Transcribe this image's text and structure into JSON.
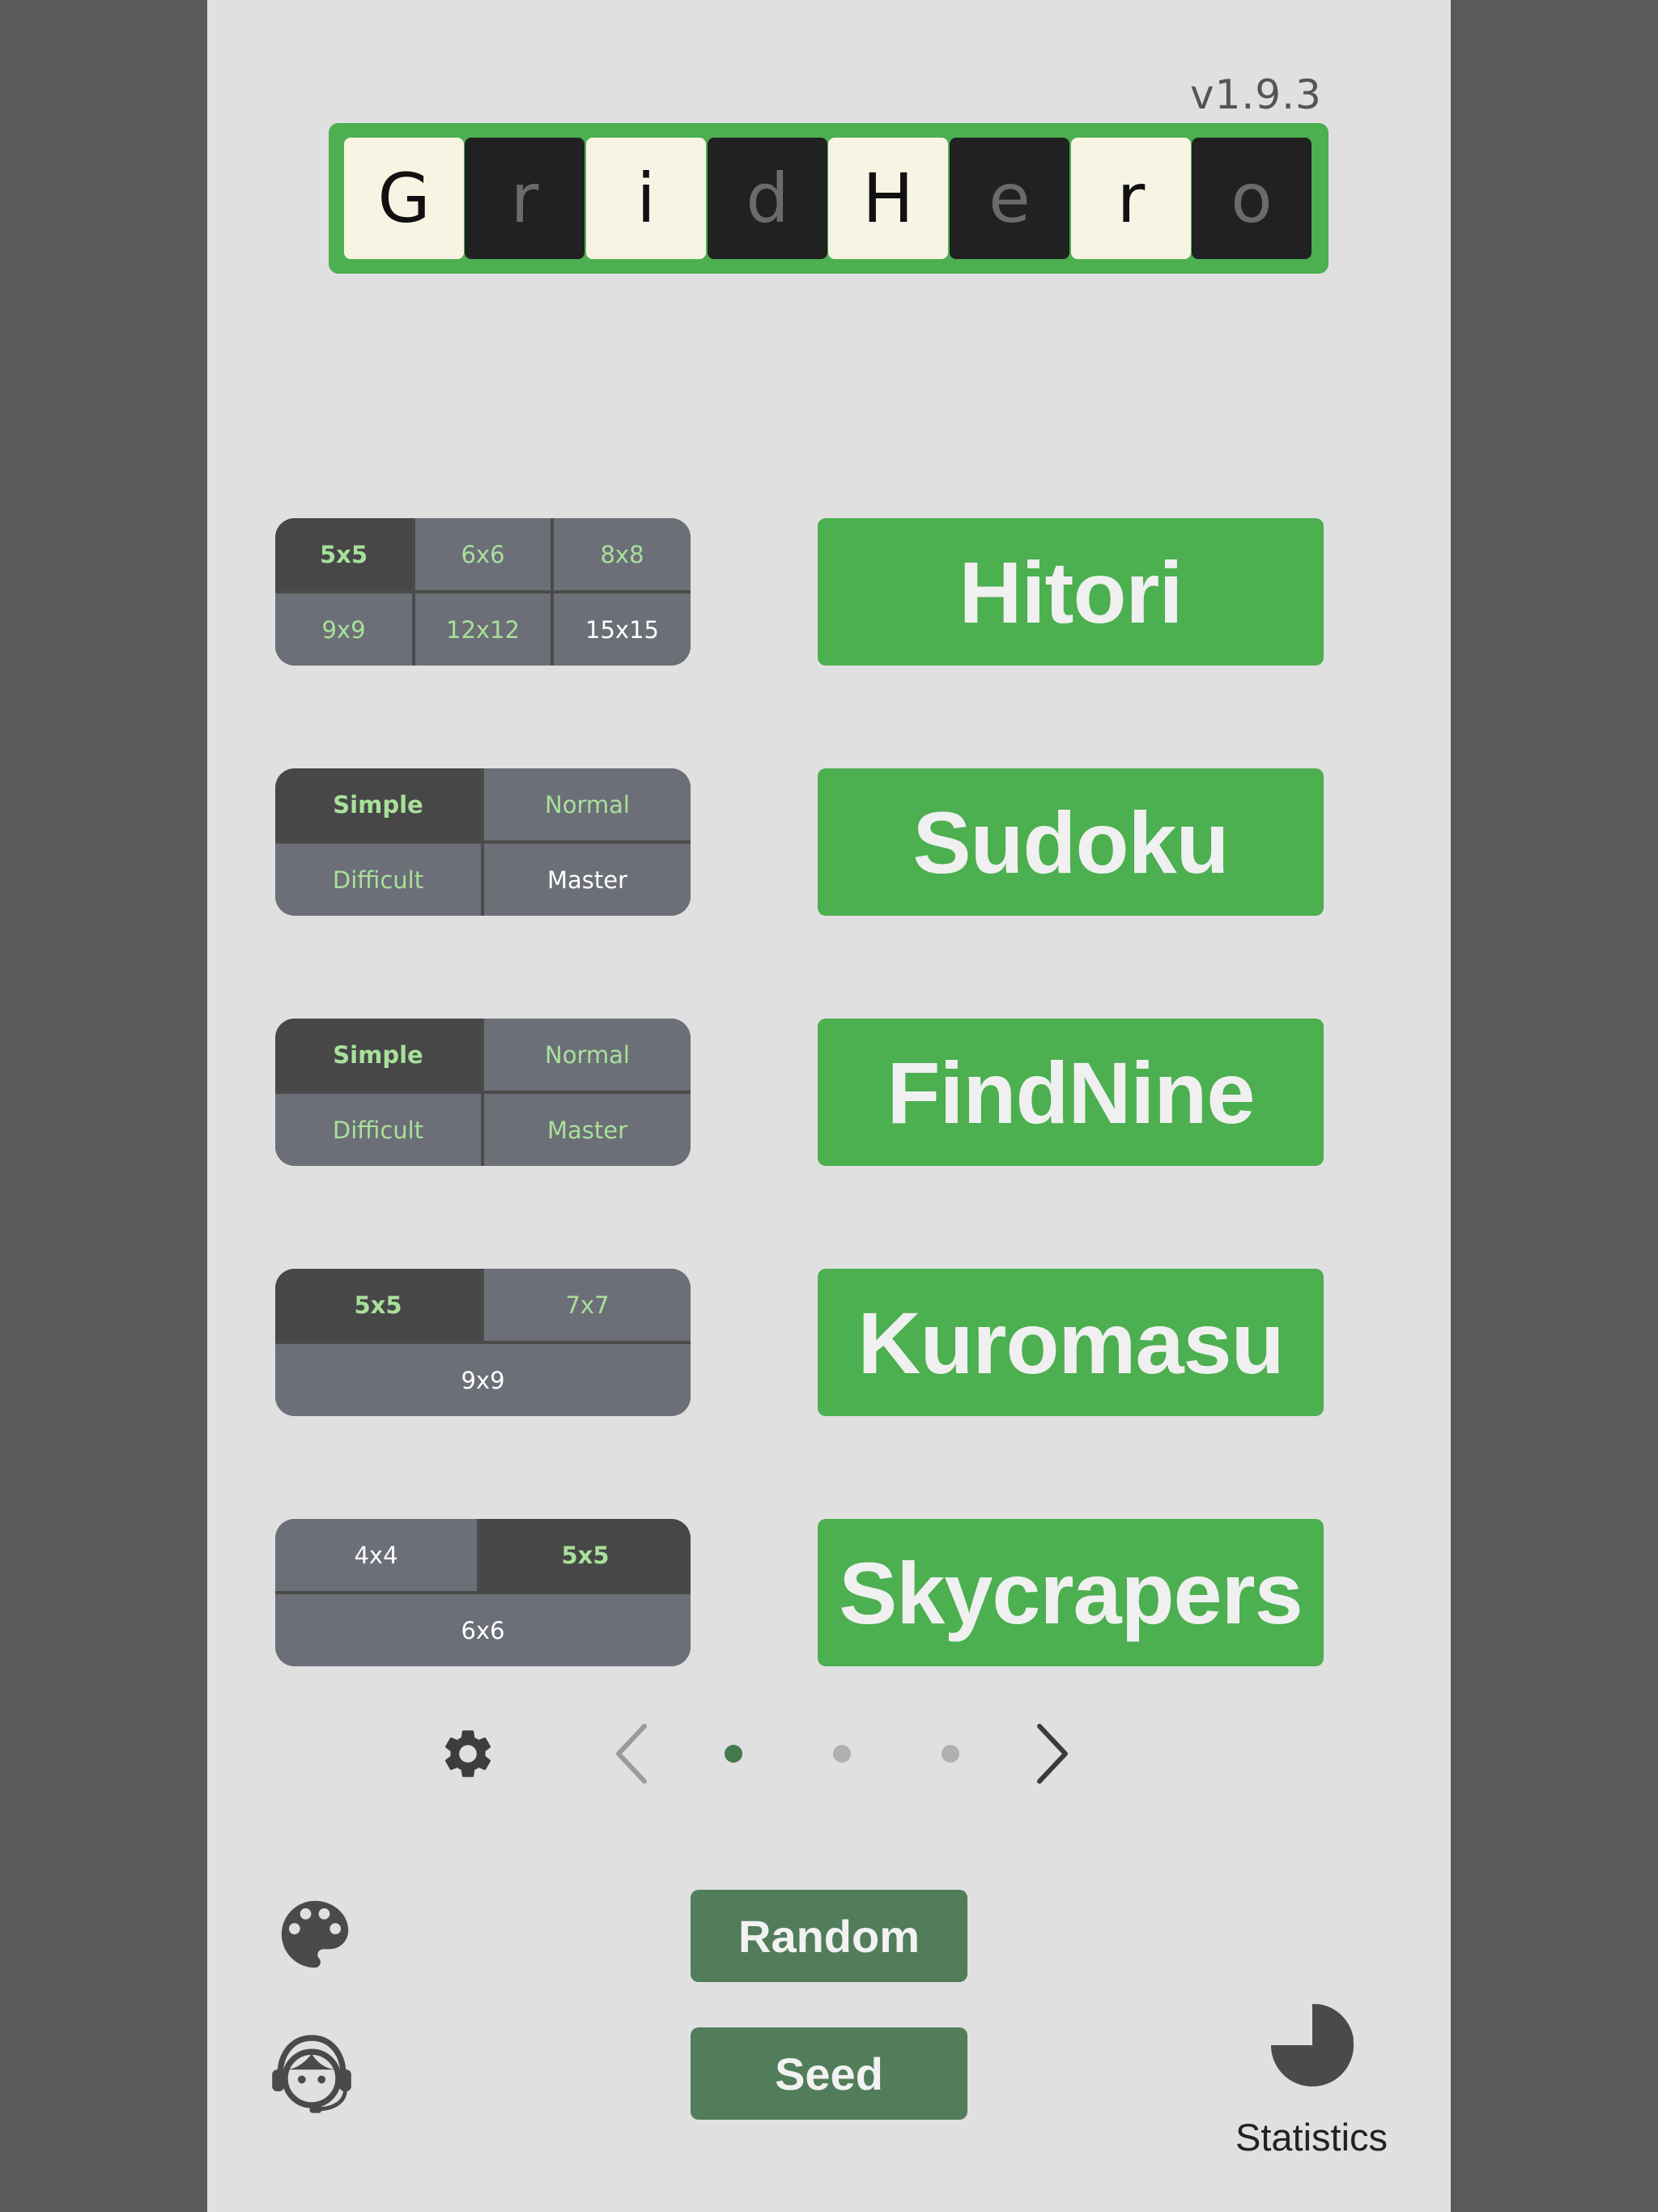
{
  "version": "v1.9.3",
  "logo": {
    "tiles": [
      "G",
      "r",
      "i",
      "d",
      "H",
      "e",
      "r",
      "o"
    ]
  },
  "rows": [
    {
      "id": "hitori",
      "options": [
        {
          "label": "5x5",
          "selected": true
        },
        {
          "label": "6x6",
          "selected": false
        },
        {
          "label": "8x8",
          "selected": false
        },
        {
          "label": "9x9",
          "selected": false
        },
        {
          "label": "12x12",
          "selected": false
        },
        {
          "label": "15x15",
          "selected": false
        }
      ],
      "button": "Hitori"
    },
    {
      "id": "sudoku",
      "options": [
        {
          "label": "Simple",
          "selected": true
        },
        {
          "label": "Normal",
          "selected": false
        },
        {
          "label": "Difficult",
          "selected": false
        },
        {
          "label": "Master",
          "selected": false
        }
      ],
      "button": "Sudoku"
    },
    {
      "id": "findnine",
      "options": [
        {
          "label": "Simple",
          "selected": true
        },
        {
          "label": "Normal",
          "selected": false
        },
        {
          "label": "Difficult",
          "selected": false
        },
        {
          "label": "Master",
          "selected": false
        }
      ],
      "button": "FindNine"
    },
    {
      "id": "kuromasu",
      "options": [
        {
          "label": "5x5",
          "selected": true
        },
        {
          "label": "7x7",
          "selected": false
        },
        {
          "label": "9x9",
          "selected": false
        }
      ],
      "button": "Kuromasu"
    },
    {
      "id": "skycrapers",
      "options": [
        {
          "label": "4x4",
          "selected": false
        },
        {
          "label": "5x5",
          "selected": true
        },
        {
          "label": "6x6",
          "selected": false
        }
      ],
      "button": "Skycrapers"
    }
  ],
  "pager": {
    "page_count": 3,
    "active_page": 1
  },
  "icons": {
    "settings": "gear-icon",
    "prev": "chevron-left-icon",
    "next": "chevron-right-icon",
    "theme": "palette-icon",
    "support": "support-agent-icon",
    "stats": "pie-chart-icon"
  },
  "actions": {
    "random": "Random",
    "seed": "Seed",
    "statistics": "Statistics"
  },
  "colors": {
    "accent": "#4caf50",
    "accent_dark": "#527d5a",
    "selected_segment": "#474747",
    "segment": "#6c6f77",
    "segment_text": "#a8e09a"
  }
}
